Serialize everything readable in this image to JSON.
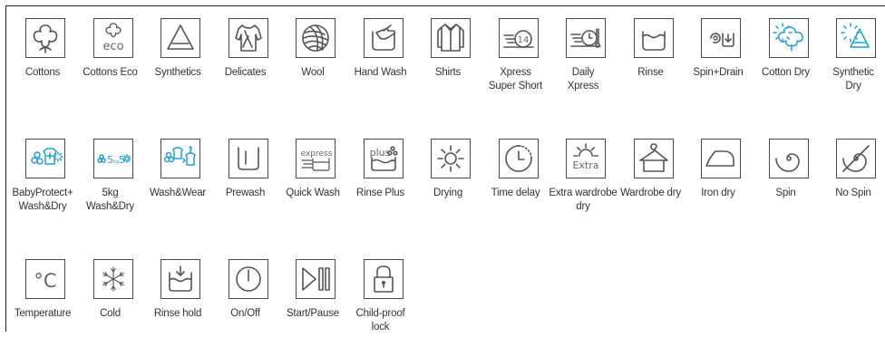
{
  "programs": [
    {
      "label": "Cottons",
      "icon": "cotton-icon"
    },
    {
      "label": "Cottons Eco",
      "icon": "cotton-eco-icon",
      "icon_text": "eco"
    },
    {
      "label": "Synthetics",
      "icon": "triangle-icon"
    },
    {
      "label": "Delicates",
      "icon": "blouse-icon"
    },
    {
      "label": "Wool",
      "icon": "wool-ball-icon"
    },
    {
      "label": "Hand Wash",
      "icon": "hand-wash-icon"
    },
    {
      "label": "Shirts",
      "icon": "shirt-icon"
    },
    {
      "label": "Xpress\nSuper Short",
      "icon": "xpress-14-icon",
      "icon_text": "14"
    },
    {
      "label": "Daily\nXpress",
      "icon": "daily-xpress-icon"
    },
    {
      "label": "Rinse",
      "icon": "rinse-icon"
    },
    {
      "label": "Spin+Drain",
      "icon": "spin-drain-icon"
    },
    {
      "label": "Cotton Dry",
      "icon": "cotton-dry-icon"
    },
    {
      "label": "Synthetic\nDry",
      "icon": "synthetic-dry-icon"
    },
    {
      "label": "BabyProtect+\nWash&Dry",
      "icon": "baby-protect-icon"
    },
    {
      "label": "5kg\nWash&Dry",
      "icon": "5kg-wash-dry-icon",
      "icon_text": "5kg 5"
    },
    {
      "label": "Wash&Wear",
      "icon": "wash-wear-icon"
    },
    {
      "label": "Prewash",
      "icon": "prewash-icon"
    },
    {
      "label": "Quick Wash",
      "icon": "quick-wash-icon",
      "icon_text": "express"
    },
    {
      "label": "Rinse Plus",
      "icon": "rinse-plus-icon",
      "icon_text": "plus"
    },
    {
      "label": "Drying",
      "icon": "sun-icon"
    },
    {
      "label": "Time delay",
      "icon": "timer-icon"
    },
    {
      "label": "Extra wardrobe\ndry",
      "icon": "extra-sun-icon",
      "icon_text": "Extra"
    },
    {
      "label": "Wardrobe dry",
      "icon": "hanger-icon"
    },
    {
      "label": "Iron dry",
      "icon": "iron-icon"
    },
    {
      "label": "Spin",
      "icon": "spin-icon"
    },
    {
      "label": "No Spin",
      "icon": "no-spin-icon"
    },
    {
      "label": "Temperature",
      "icon": "temperature-icon",
      "icon_text": "°C"
    },
    {
      "label": "Cold",
      "icon": "snowflake-icon"
    },
    {
      "label": "Rinse hold",
      "icon": "rinse-hold-icon"
    },
    {
      "label": "On/Off",
      "icon": "power-icon"
    },
    {
      "label": "Start/Pause",
      "icon": "start-pause-icon"
    },
    {
      "label": "Child-proof\nlock",
      "icon": "padlock-icon"
    }
  ],
  "colors": {
    "icon_gray": "#555555",
    "icon_blue": "#1f9fd8",
    "text": "#333333",
    "border": "#4a4a4a"
  }
}
